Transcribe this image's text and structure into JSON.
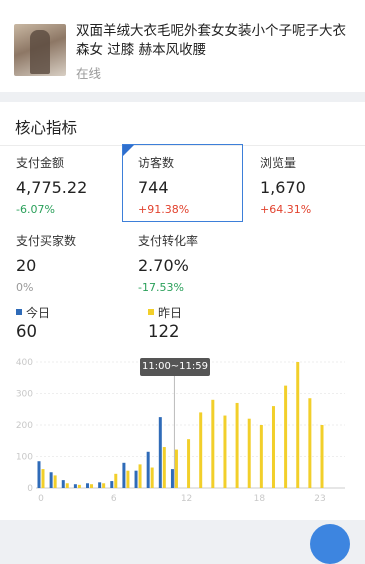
{
  "product": {
    "title": "双面羊绒大衣毛呢外套女女装小个子呢子大衣森女 过膝 赫本风收腰",
    "status": "在线"
  },
  "section_title": "核心指标",
  "metrics": [
    {
      "label": "支付金额",
      "value": "4,775.22",
      "change": "-6.07%",
      "trend": "down"
    },
    {
      "label": "访客数",
      "value": "744",
      "change": "+91.38%",
      "trend": "up",
      "selected": true
    },
    {
      "label": "浏览量",
      "value": "1,670",
      "change": "+64.31%",
      "trend": "up"
    },
    {
      "label": "支付买家数",
      "value": "20",
      "change": "0%",
      "trend": "flat"
    },
    {
      "label": "支付转化率",
      "value": "2.70%",
      "change": "-17.53%",
      "trend": "down"
    }
  ],
  "legend": {
    "today": {
      "label": "今日",
      "value": "60",
      "color": "#2f6bb8"
    },
    "yesterday": {
      "label": "昨日",
      "value": "122",
      "color": "#f2cf2a"
    }
  },
  "tooltip": "11:00~11:59",
  "chart_data": {
    "type": "bar",
    "x": [
      0,
      1,
      2,
      3,
      4,
      5,
      6,
      7,
      8,
      9,
      10,
      11,
      12,
      13,
      14,
      15,
      16,
      17,
      18,
      19,
      20,
      21,
      22,
      23
    ],
    "xticks": [
      "0",
      "6",
      "12",
      "18",
      "23"
    ],
    "yticks": [
      "0",
      "100",
      "200",
      "300",
      "400"
    ],
    "ylim": [
      0,
      400
    ],
    "series": [
      {
        "name": "今日",
        "values": [
          85,
          50,
          25,
          12,
          15,
          18,
          22,
          80,
          55,
          115,
          225,
          60
        ]
      },
      {
        "name": "昨日",
        "values": [
          60,
          40,
          15,
          10,
          12,
          15,
          45,
          55,
          75,
          65,
          130,
          122,
          155,
          240,
          280,
          230,
          270,
          220,
          200,
          260,
          325,
          400,
          285,
          200
        ]
      }
    ],
    "highlight_hour": 11
  }
}
